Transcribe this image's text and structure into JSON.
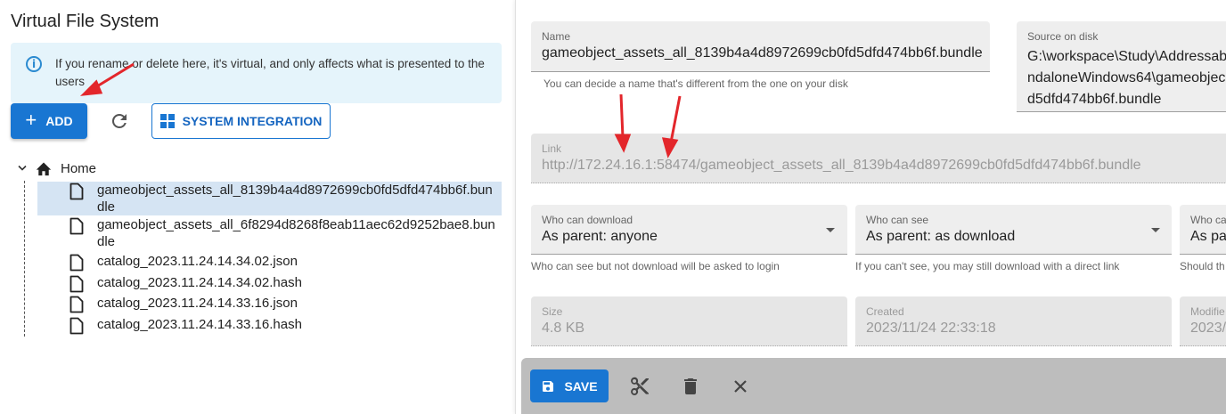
{
  "left": {
    "title": "Virtual File System",
    "info_text": "If you rename or delete here, it's virtual, and only affects what is presented to the users",
    "add_label": "ADD",
    "system_integration_label": "SYSTEM INTEGRATION",
    "tree": {
      "root_label": "Home",
      "files": [
        {
          "name": "gameobject_assets_all_8139b4a4d8972699cb0fd5dfd474bb6f.bundle",
          "selected": true
        },
        {
          "name": "gameobject_assets_all_6f8294d8268f8eab11aec62d9252bae8.bundle",
          "selected": false
        },
        {
          "name": "catalog_2023.11.24.14.34.02.json",
          "selected": false
        },
        {
          "name": "catalog_2023.11.24.14.34.02.hash",
          "selected": false
        },
        {
          "name": "catalog_2023.11.24.14.33.16.json",
          "selected": false
        },
        {
          "name": "catalog_2023.11.24.14.33.16.hash",
          "selected": false
        }
      ]
    }
  },
  "details": {
    "name_label": "Name",
    "name_value": "gameobject_assets_all_8139b4a4d8972699cb0fd5dfd474bb6f.bundle",
    "name_helper": "You can decide a name that's different from the one on your disk",
    "source_label": "Source on disk",
    "source_lines": [
      "G:\\workspace\\Study\\Addressab",
      "ndaloneWindows64\\gameobjec",
      "d5dfd474bb6f.bundle"
    ],
    "link_label": "Link",
    "link_value": "http://172.24.16.1:58474/gameobject_assets_all_8139b4a4d8972699cb0fd5dfd474bb6f.bundle",
    "who_download_label": "Who can download",
    "who_download_value": "As parent: anyone",
    "who_download_helper": "Who can see but not download will be asked to login",
    "who_see_label": "Who can see",
    "who_see_value": "As parent: as download",
    "who_see_helper": "If you can't see, you may still download with a direct link",
    "third_label": "Who ca",
    "third_value": "As pa",
    "third_helper": "Should th",
    "size_label": "Size",
    "size_value": "4.8 KB",
    "created_label": "Created",
    "created_value": "2023/11/24 22:33:18",
    "modified_label": "Modifie",
    "modified_value": "2023/"
  },
  "toolbar": {
    "save_label": "SAVE"
  },
  "colors": {
    "primary": "#1976d2",
    "info_bg": "#e5f4fb",
    "selected_bg": "#d5e4f3",
    "annotation_red": "#e3262b"
  }
}
